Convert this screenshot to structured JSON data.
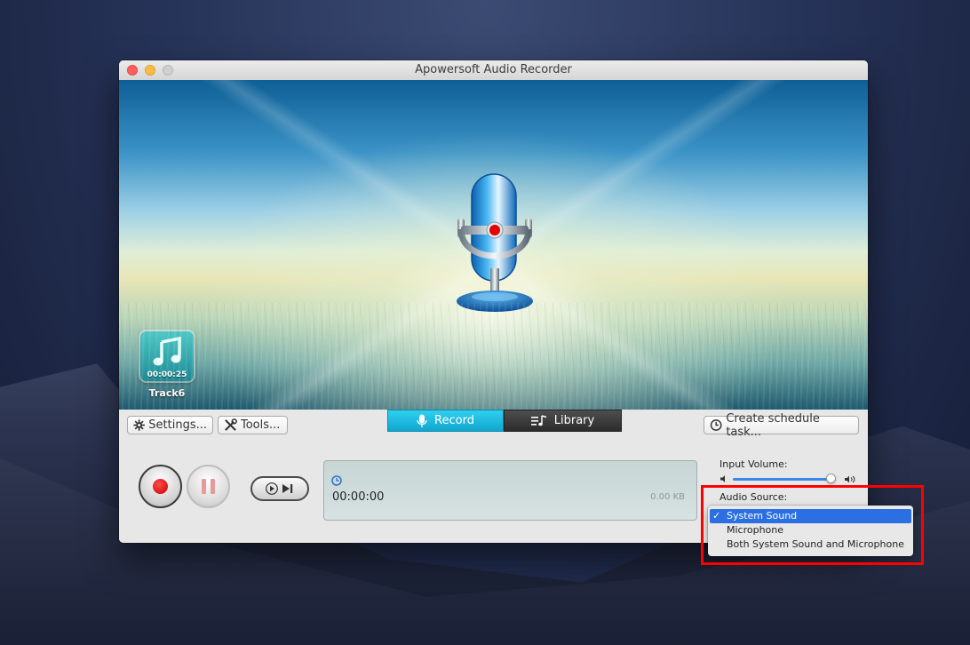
{
  "window": {
    "title": "Apowersoft Audio Recorder"
  },
  "track": {
    "name": "Track6",
    "duration": "00:00:25"
  },
  "toolbar": {
    "settings_label": "Settings...",
    "tools_label": "Tools...",
    "record_tab": "Record",
    "library_tab": "Library",
    "schedule_label": "Create schedule task..."
  },
  "status": {
    "timer": "00:00:00",
    "size": "0.00 KB"
  },
  "volume": {
    "label": "Input Volume:",
    "level": 0.95
  },
  "audio_source": {
    "label": "Audio Source:",
    "options": [
      {
        "label": "System Sound",
        "selected": true
      },
      {
        "label": "Microphone",
        "selected": false
      },
      {
        "label": "Both System Sound and Microphone",
        "selected": false
      }
    ]
  },
  "colors": {
    "accent": "#2b6fe3",
    "record_tab": "#1fbde3",
    "highlight": "#ff0000"
  }
}
